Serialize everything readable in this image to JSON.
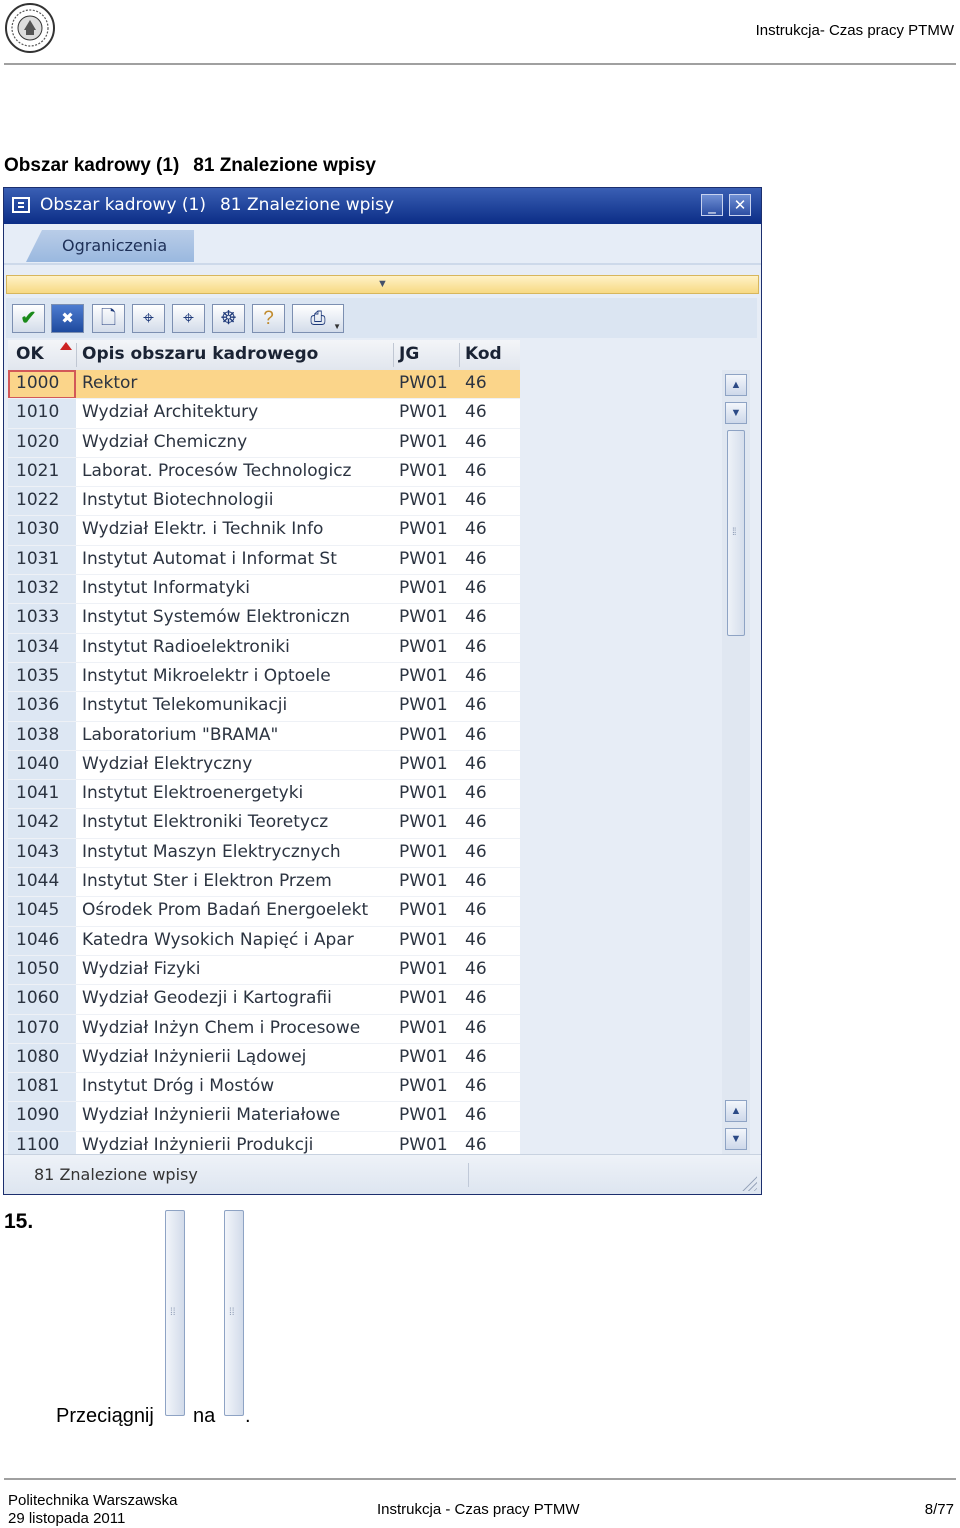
{
  "header": {
    "doc_title": "Instrukcja- Czas pracy PTMW"
  },
  "caption": {
    "part1": "Obszar kadrowy (1)",
    "part2": "81 Znalezione wpisy"
  },
  "window": {
    "title_part1": "Obszar kadrowy (1)",
    "title_part2": "81 Znalezione wpisy",
    "minimize_glyph": "_",
    "close_glyph": "✕",
    "tab_label": "Ograniczenia",
    "toolbar_icons": [
      "check-icon",
      "cancel-icon",
      "new-document-icon",
      "find-icon",
      "find-next-icon",
      "multiple-selection-icon",
      "help-icon",
      "print-icon"
    ]
  },
  "table": {
    "columns": [
      "OK",
      "Opis obszaru kadrowego",
      "JG",
      "Kod"
    ],
    "rows": [
      [
        "1000",
        "Rektor",
        "PW01",
        "46"
      ],
      [
        "1010",
        "Wydział Architektury",
        "PW01",
        "46"
      ],
      [
        "1020",
        "Wydział Chemiczny",
        "PW01",
        "46"
      ],
      [
        "1021",
        "Laborat. Procesów Technologicz",
        "PW01",
        "46"
      ],
      [
        "1022",
        "Instytut Biotechnologii",
        "PW01",
        "46"
      ],
      [
        "1030",
        "Wydział Elektr. i Technik Info",
        "PW01",
        "46"
      ],
      [
        "1031",
        "Instytut Automat i Informat St",
        "PW01",
        "46"
      ],
      [
        "1032",
        "Instytut Informatyki",
        "PW01",
        "46"
      ],
      [
        "1033",
        "Instytut Systemów Elektroniczn",
        "PW01",
        "46"
      ],
      [
        "1034",
        "Instytut Radioelektroniki",
        "PW01",
        "46"
      ],
      [
        "1035",
        "Instytut Mikroelektr i Optoele",
        "PW01",
        "46"
      ],
      [
        "1036",
        "Instytut Telekomunikacji",
        "PW01",
        "46"
      ],
      [
        "1038",
        "Laboratorium \"BRAMA\"",
        "PW01",
        "46"
      ],
      [
        "1040",
        "Wydział Elektryczny",
        "PW01",
        "46"
      ],
      [
        "1041",
        "Instytut Elektroenergetyki",
        "PW01",
        "46"
      ],
      [
        "1042",
        "Instytut Elektroniki Teoretycz",
        "PW01",
        "46"
      ],
      [
        "1043",
        "Instytut Maszyn Elektrycznych",
        "PW01",
        "46"
      ],
      [
        "1044",
        "Instytut Ster i Elektron Przem",
        "PW01",
        "46"
      ],
      [
        "1045",
        "Ośrodek Prom Badań Energoelekt",
        "PW01",
        "46"
      ],
      [
        "1046",
        "Katedra Wysokich Napięć i Apar",
        "PW01",
        "46"
      ],
      [
        "1050",
        "Wydział Fizyki",
        "PW01",
        "46"
      ],
      [
        "1060",
        "Wydział Geodezji i Kartografii",
        "PW01",
        "46"
      ],
      [
        "1070",
        "Wydział Inżyn Chem i Procesowe",
        "PW01",
        "46"
      ],
      [
        "1080",
        "Wydział Inżynierii Lądowej",
        "PW01",
        "46"
      ],
      [
        "1081",
        "Instytut Dróg i Mostów",
        "PW01",
        "46"
      ],
      [
        "1090",
        "Wydział Inżynierii Materiałowe",
        "PW01",
        "46"
      ],
      [
        "1100",
        "Wydział Inżynierii Produkcji",
        "PW01",
        "46"
      ]
    ],
    "selected_row": 0
  },
  "status": {
    "text": "81 Znalezione wpisy"
  },
  "step": {
    "number": "15.",
    "word_drag": "Przeciągnij",
    "word_onto": "na",
    "period": "."
  },
  "footer": {
    "org": "Politechnika Warszawska",
    "date": "29 listopada 2011",
    "title": "Instrukcja - Czas pracy PTMW",
    "page": "8/77"
  },
  "colors": {
    "selection": "#fbd58a",
    "titlebar": "#0b2d86",
    "window_bg": "#e7edf6"
  }
}
